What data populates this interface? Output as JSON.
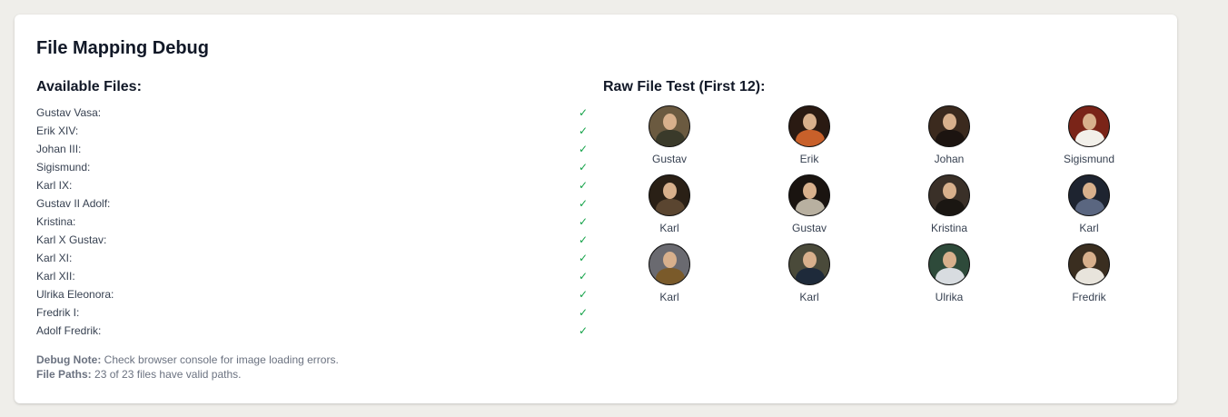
{
  "title": "File Mapping Debug",
  "available": {
    "heading": "Available Files:",
    "check_symbol": "✓",
    "files": [
      "Gustav Vasa:",
      "Erik XIV:",
      "Johan III:",
      "Sigismund:",
      "Karl IX:",
      "Gustav II Adolf:",
      "Kristina:",
      "Karl X Gustav:",
      "Karl XI:",
      "Karl XII:",
      "Ulrika Eleonora:",
      "Fredrik I:",
      "Adolf Fredrik:"
    ]
  },
  "raw_test": {
    "heading": "Raw File Test (First 12):",
    "portraits": [
      {
        "name": "Gustav",
        "bg": "#6b5a40",
        "body": "#3a3a2a"
      },
      {
        "name": "Erik",
        "bg": "#2a1a12",
        "body": "#c8602a"
      },
      {
        "name": "Johan",
        "bg": "#3b2a1e",
        "body": "#1c1410"
      },
      {
        "name": "Sigismund",
        "bg": "#7a2418",
        "body": "#f2f0ea"
      },
      {
        "name": "Karl",
        "bg": "#2a2016",
        "body": "#5a4530"
      },
      {
        "name": "Gustav",
        "bg": "#1a1410",
        "body": "#b8b0a0"
      },
      {
        "name": "Kristina",
        "bg": "#3a3028",
        "body": "#1a1612"
      },
      {
        "name": "Karl",
        "bg": "#1e2430",
        "body": "#5a6680"
      },
      {
        "name": "Karl",
        "bg": "#6a6a70",
        "body": "#7a5a2a"
      },
      {
        "name": "Karl",
        "bg": "#4a4a3a",
        "body": "#1e2a3a"
      },
      {
        "name": "Ulrika",
        "bg": "#2e4a3a",
        "body": "#d8dce0"
      },
      {
        "name": "Fredrik",
        "bg": "#3a2e20",
        "body": "#e8e4dc"
      }
    ]
  },
  "notes": {
    "debug_label": "Debug Note:",
    "debug_text": "Check browser console for image loading errors.",
    "paths_label": "File Paths:",
    "paths_text": "23 of 23 files have valid paths."
  }
}
